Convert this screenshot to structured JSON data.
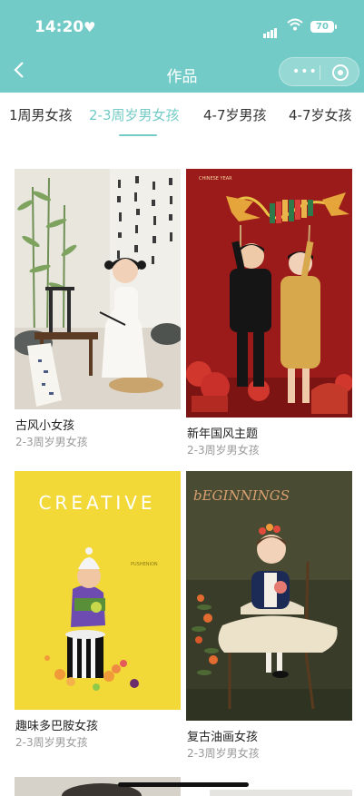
{
  "status": {
    "time": "14:20",
    "battery": "70"
  },
  "nav": {
    "title": "作品"
  },
  "tabs": [
    {
      "label": "1周男女孩"
    },
    {
      "label": "2-3周岁男女孩"
    },
    {
      "label": "4-7岁男孩"
    },
    {
      "label": "4-7岁女孩"
    }
  ],
  "works": [
    {
      "title": "古风小女孩",
      "category": "2-3周岁男女孩"
    },
    {
      "title": "新年国风主题",
      "category": "2-3周岁男女孩",
      "photo_text": "CHINESE YEAR"
    },
    {
      "title": "趣味多巴胺女孩",
      "category": "2-3周岁男女孩",
      "photo_text": "CREATIVE",
      "photo_subtext": "PUSHENION"
    },
    {
      "title": "复古油画女孩",
      "category": "2-3周岁男女孩",
      "photo_text": "bEGINNINGS"
    }
  ],
  "colors": {
    "accent": "#72cbc6",
    "muted": "#999999"
  }
}
